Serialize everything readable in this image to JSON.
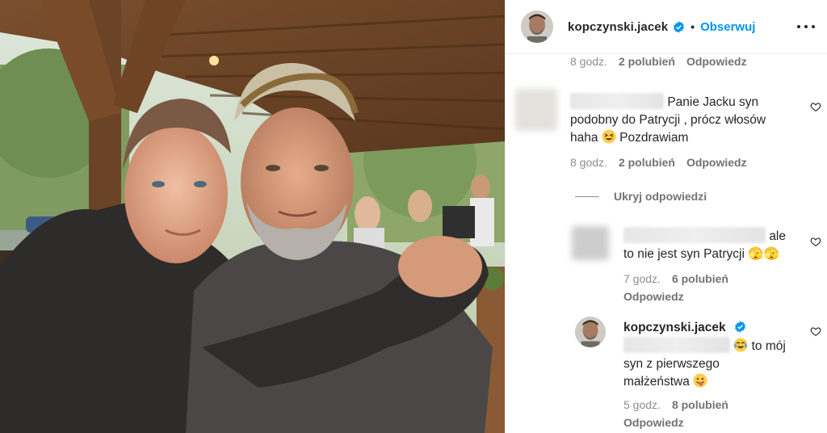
{
  "post": {
    "author": "kopczynski.jacek",
    "follow_label": "Obserwuj",
    "dot": "•"
  },
  "top_meta": {
    "time": "8 godz.",
    "likes": "2 polubień",
    "reply": "Odpowiedz"
  },
  "comments": [
    {
      "text": "Panie Jacku syn podobny do Patrycji , prócz włosów haha",
      "text_line1": "Panie Jacku syn",
      "text_line2": "podobny do Patrycji , prócz włosów",
      "text_line3a": "haha",
      "emoji": "😆",
      "text_line3b": "Pozdrawiam",
      "time": "8 godz.",
      "likes": "2 polubień",
      "reply": "Odpowiedz"
    }
  ],
  "hide_replies": "Ukryj odpowiedzi",
  "replies": [
    {
      "text_line1": "ale",
      "text_line2": "to nie jest syn Patrycji",
      "trailing": "🫣🫣",
      "time": "7 godz.",
      "likes": "6 polubień",
      "reply": "Odpowiedz"
    },
    {
      "author": "kopczynski.jacek",
      "emoji": "😂",
      "text_line1": "to mój",
      "text_line2": "syn z pierwszego",
      "text_line3": "małżeństwa",
      "emoji2": "😛",
      "time": "5 godz.",
      "likes": "8 polubień",
      "reply": "Odpowiedz"
    }
  ],
  "colors": {
    "accent": "#0095f6",
    "verified": "#0095f6",
    "muted": "#8e8e8e",
    "border": "#efefef"
  },
  "icons": [
    "verified-badge-icon",
    "more-options-icon",
    "heart-icon"
  ]
}
